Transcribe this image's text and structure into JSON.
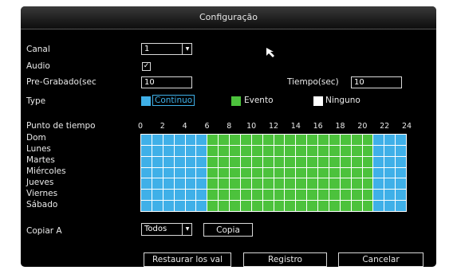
{
  "title": "Configuração",
  "canal": {
    "label": "Canal",
    "value": "1"
  },
  "audio": {
    "label": "Audio",
    "checked": true
  },
  "pre": {
    "label": "Pre-Grabado(sec",
    "value": "10"
  },
  "tiempo": {
    "label": "Tiempo(sec)",
    "value": "10"
  },
  "type": {
    "label": "Type",
    "legend": [
      {
        "label": "Continuo",
        "color": "#3fb0e8"
      },
      {
        "label": "Evento",
        "color": "#4cc23c"
      },
      {
        "label": "Ninguno",
        "color": "#ffffff"
      }
    ]
  },
  "schedule": {
    "label": "Punto de tiempo",
    "hours": [
      "0",
      "2",
      "4",
      "6",
      "8",
      "10",
      "12",
      "14",
      "16",
      "18",
      "20",
      "22",
      "24"
    ],
    "days": [
      "Dom",
      "Lunes",
      "Martes",
      "Miércoles",
      "Jueves",
      "Viernes",
      "Sábado"
    ],
    "blue": "#3fb0e8",
    "green": "#4cc23c",
    "pattern": [
      "C",
      "C",
      "C",
      "C",
      "C",
      "C",
      "E",
      "E",
      "E",
      "E",
      "E",
      "E",
      "E",
      "E",
      "E",
      "E",
      "E",
      "E",
      "E",
      "E",
      "E",
      "C",
      "C",
      "C"
    ]
  },
  "copiar": {
    "label": "Copiar A",
    "value": "Todos",
    "button": "Copia"
  },
  "buttons": {
    "restore": "Restaurar los val",
    "save": "Registro",
    "cancel": "Cancelar"
  }
}
